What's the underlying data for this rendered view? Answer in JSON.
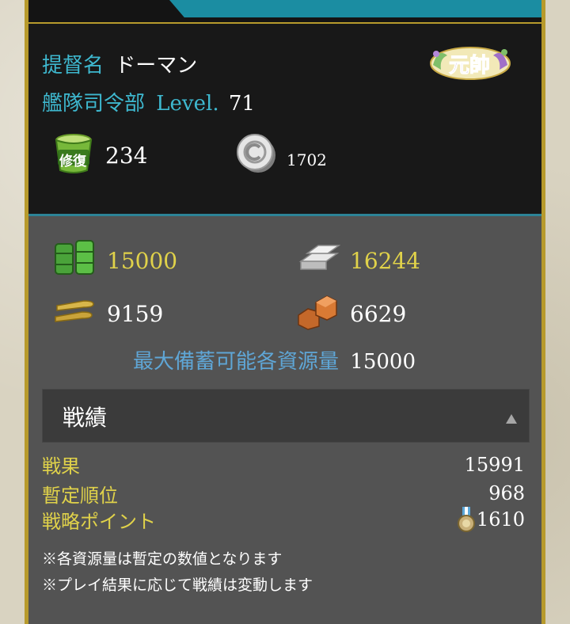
{
  "admiral": {
    "name_label": "提督名",
    "name": "ドーマン",
    "rank_badge": "元帥"
  },
  "hq": {
    "label": "艦隊司令部",
    "level_label": "Level.",
    "level": "71"
  },
  "items": [
    {
      "icon": "repair-bucket-icon",
      "label": "修復",
      "value": "234"
    },
    {
      "icon": "coin-icon",
      "value": "1702"
    }
  ],
  "resources": [
    {
      "name": "fuel",
      "icon": "fuel-barrel-icon",
      "value": "15000",
      "color": "#e0d24a"
    },
    {
      "name": "steel",
      "icon": "steel-ingot-icon",
      "value": "16244",
      "color": "#e0d24a"
    },
    {
      "name": "ammo",
      "icon": "ammo-icon",
      "value": "9159",
      "color": "#ffffff"
    },
    {
      "name": "bauxite",
      "icon": "bauxite-icon",
      "value": "6629",
      "color": "#ffffff"
    }
  ],
  "max_storage": {
    "label": "最大備蓄可能各資源量",
    "value": "15000"
  },
  "record": {
    "title": "戦績",
    "toggle_icon": "triangle-up-icon",
    "rows": [
      {
        "label": "戦果",
        "value": "15991"
      },
      {
        "label": "暫定順位",
        "value": "968"
      },
      {
        "label": "戦略ポイント",
        "value": "1610",
        "icon": "medal-icon"
      }
    ]
  },
  "notes": [
    "※各資源量は暫定の数値となります",
    "※プレイ結果に応じて戦績は変動します"
  ],
  "colors": {
    "accent_cyan": "#3eb8cf",
    "gold_border": "#b79a2c",
    "yellow_text": "#e0d24a"
  }
}
